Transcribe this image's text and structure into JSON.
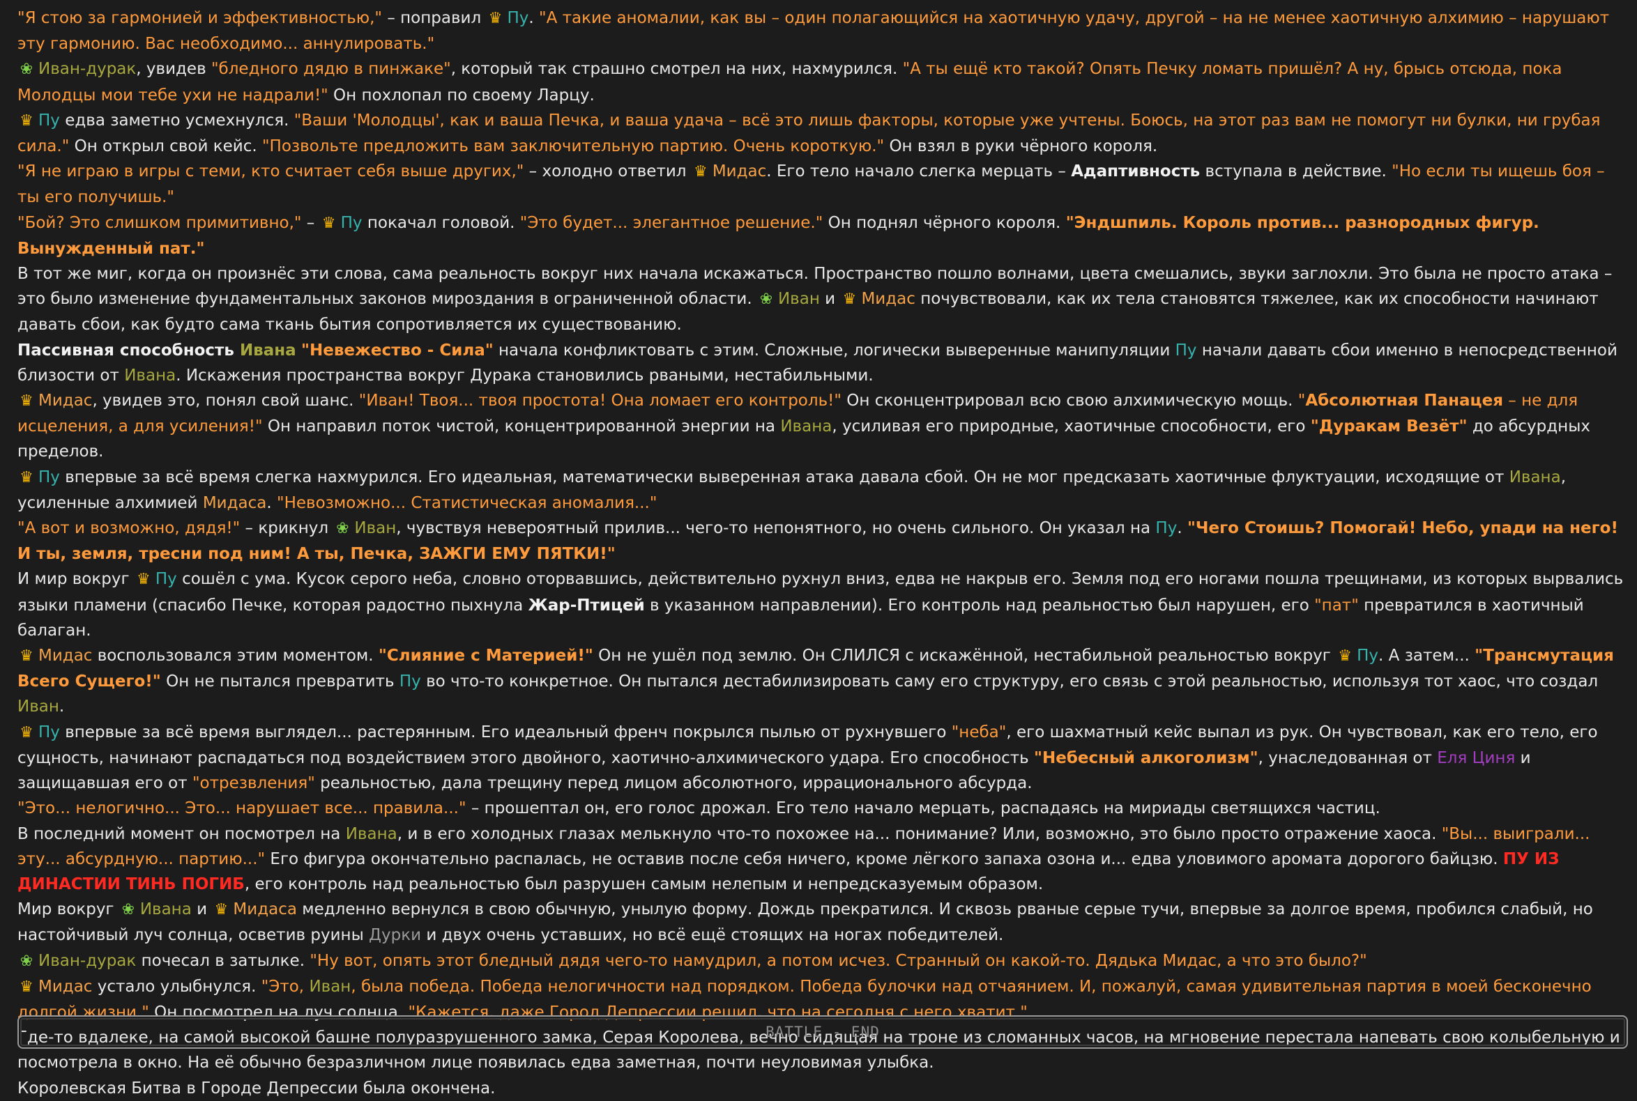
{
  "footer": {
    "label": "BATTLE - END"
  },
  "icons": {
    "crown": "crown-icon",
    "sprout": "sprout-icon"
  },
  "colors": {
    "quote": "#ff9b3c",
    "ivan": "#a7a83f",
    "pu": "#37b3ae",
    "midas": "#f4a24a",
    "durki": "#9a9a9a",
    "elya": "#a43ec0",
    "alert": "#ff2a22",
    "crown": "#f4b400",
    "sprout": "#7fd04a"
  },
  "paragraphs": [
    [
      {
        "c": "q",
        "t": "\"Я стою за гармонией и эффективностью,\""
      },
      {
        "c": "",
        "t": " – поправил "
      },
      {
        "i": "crown"
      },
      {
        "c": "pu",
        "t": "Пу"
      },
      {
        "c": "",
        "t": ". "
      },
      {
        "c": "q",
        "t": "\"А такие аномалии, как вы – один полагающийся на хаотичную удачу, другой – на не менее хаотичную алхимию – нарушают эту гармонию. Вас необходимо... аннулировать.\""
      }
    ],
    [
      {
        "i": "sprout"
      },
      {
        "c": "ivan",
        "t": "Иван-дурак"
      },
      {
        "c": "",
        "t": ", увидев "
      },
      {
        "c": "q",
        "t": "\"бледного дядю в пинжаке\""
      },
      {
        "c": "",
        "t": ", который так страшно смотрел на них, нахмурился. "
      },
      {
        "c": "q",
        "t": "\"А ты ещё кто такой? Опять Печку ломать пришёл? А ну, брысь отсюда, пока Молодцы мои тебе ухи не надрали!\""
      },
      {
        "c": "",
        "t": " Он похлопал по своему Ларцу."
      }
    ],
    [
      {
        "i": "crown"
      },
      {
        "c": "pu",
        "t": "Пу"
      },
      {
        "c": "",
        "t": " едва заметно усмехнулся. "
      },
      {
        "c": "q",
        "t": "\"Ваши 'Молодцы', как и ваша Печка, и ваша удача – всё это лишь факторы, которые уже учтены. Боюсь, на этот раз вам не помогут ни булки, ни грубая сила.\""
      },
      {
        "c": "",
        "t": " Он открыл свой кейс. "
      },
      {
        "c": "q",
        "t": "\"Позвольте предложить вам заключительную партию. Очень короткую.\""
      },
      {
        "c": "",
        "t": " Он взял в руки чёрного короля."
      }
    ],
    [
      {
        "c": "q",
        "t": "\"Я не играю в игры с теми, кто считает себя выше других,\""
      },
      {
        "c": "",
        "t": " – холодно ответил "
      },
      {
        "i": "crown"
      },
      {
        "c": "midas",
        "t": "Мидас"
      },
      {
        "c": "",
        "t": ". Его тело начало слегка мерцать – "
      },
      {
        "c": "b",
        "t": "Адаптивность"
      },
      {
        "c": "",
        "t": " вступала в действие. "
      },
      {
        "c": "q",
        "t": "\"Но если ты ищешь боя – ты его получишь.\""
      }
    ],
    [
      {
        "c": "q",
        "t": "\"Бой? Это слишком примитивно,\""
      },
      {
        "c": "",
        "t": " – "
      },
      {
        "i": "crown"
      },
      {
        "c": "pu",
        "t": "Пу"
      },
      {
        "c": "",
        "t": " покачал головой. "
      },
      {
        "c": "q",
        "t": "\"Это будет... элегантное решение.\""
      },
      {
        "c": "",
        "t": " Он поднял чёрного короля. "
      },
      {
        "c": "qb",
        "t": "\"Эндшпиль. Король против... разнородных фигур. Вынужденный пат.\""
      }
    ],
    [
      {
        "c": "",
        "t": "В тот же миг, когда он произнёс эти слова, сама реальность вокруг них начала искажаться. Пространство пошло волнами, цвета смешались, звуки заглохли. Это была не просто атака – это было изменение фундаментальных законов мироздания в ограниченной области. "
      },
      {
        "i": "sprout"
      },
      {
        "c": "ivan",
        "t": "Иван"
      },
      {
        "c": "",
        "t": " и "
      },
      {
        "i": "crown"
      },
      {
        "c": "midas",
        "t": "Мидас"
      },
      {
        "c": "",
        "t": " почувствовали, как их тела становятся тяжелее, как их способности начинают давать сбои, как будто сама ткань бытия сопротивляется их существованию."
      }
    ],
    [
      {
        "c": "b",
        "t": "Пассивная способность "
      },
      {
        "c": "ivan",
        "t": "Ивана",
        "bold": true
      },
      {
        "c": "",
        "t": " "
      },
      {
        "c": "qb",
        "t": "\"Невежество - Сила\""
      },
      {
        "c": "",
        "t": " начала конфликтовать с этим. Сложные, логически выверенные манипуляции "
      },
      {
        "c": "pu",
        "t": "Пу"
      },
      {
        "c": "",
        "t": " начали давать сбои именно в непосредственной близости от "
      },
      {
        "c": "ivan",
        "t": "Ивана"
      },
      {
        "c": "",
        "t": ". Искажения пространства вокруг Дурака становились рваными, нестабильными."
      }
    ],
    [
      {
        "i": "crown"
      },
      {
        "c": "midas",
        "t": "Мидас"
      },
      {
        "c": "",
        "t": ", увидев это, понял свой шанс. "
      },
      {
        "c": "q",
        "t": "\"Иван! Твоя... твоя простота! Она ломает его контроль!\""
      },
      {
        "c": "",
        "t": " Он сконцентрировал всю свою алхимическую мощь. "
      },
      {
        "c": "q",
        "t": "\""
      },
      {
        "c": "qb",
        "t": "Абсолютная Панацея"
      },
      {
        "c": "q",
        "t": " – не для исцеления, а для усиления!\""
      },
      {
        "c": "",
        "t": " Он направил поток чистой, концентрированной энергии на "
      },
      {
        "c": "ivan",
        "t": "Ивана"
      },
      {
        "c": "",
        "t": ", усиливая его природные, хаотичные способности, его "
      },
      {
        "c": "qb",
        "t": "\"Дуракам Везёт\""
      },
      {
        "c": "",
        "t": " до абсурдных пределов."
      }
    ],
    [
      {
        "i": "crown"
      },
      {
        "c": "pu",
        "t": "Пу"
      },
      {
        "c": "",
        "t": " впервые за всё время слегка нахмурился. Его идеальная, математически выверенная атака давала сбой. Он не мог предсказать хаотичные флуктуации, исходящие от "
      },
      {
        "c": "ivan",
        "t": "Ивана"
      },
      {
        "c": "",
        "t": ", усиленные алхимией "
      },
      {
        "c": "midas",
        "t": "Мидаса"
      },
      {
        "c": "",
        "t": ". "
      },
      {
        "c": "q",
        "t": "\"Невозможно... Статистическая аномалия...\""
      }
    ],
    [
      {
        "c": "q",
        "t": "\"А вот и возможно, дядя!\""
      },
      {
        "c": "",
        "t": " – крикнул "
      },
      {
        "i": "sprout"
      },
      {
        "c": "ivan",
        "t": "Иван"
      },
      {
        "c": "",
        "t": ", чувствуя невероятный прилив... чего-то непонятного, но очень сильного. Он указал на "
      },
      {
        "c": "pu",
        "t": "Пу"
      },
      {
        "c": "",
        "t": ". "
      },
      {
        "c": "qb",
        "t": "\"Чего Стоишь? Помогай! Небо, упади на него! И ты, земля, тресни под ним! А ты, Печка, ЗАЖГИ ЕМУ ПЯТКИ!\""
      }
    ],
    [
      {
        "c": "",
        "t": "И мир вокруг "
      },
      {
        "i": "crown"
      },
      {
        "c": "pu",
        "t": "Пу"
      },
      {
        "c": "",
        "t": " сошёл с ума. Кусок серого неба, словно оторвавшись, действительно рухнул вниз, едва не накрыв его. Земля под его ногами пошла трещинами, из которых вырвались языки пламени (спасибо Печке, которая радостно пыхнула "
      },
      {
        "c": "b",
        "t": "Жар-Птицей"
      },
      {
        "c": "",
        "t": " в указанном направлении). Его контроль над реальностью был нарушен, его "
      },
      {
        "c": "q",
        "t": "\"пат\""
      },
      {
        "c": "",
        "t": " превратился в хаотичный балаган."
      }
    ],
    [
      {
        "i": "crown"
      },
      {
        "c": "midas",
        "t": "Мидас"
      },
      {
        "c": "",
        "t": " воспользовался этим моментом. "
      },
      {
        "c": "qb",
        "t": "\"Слияние с Материей!\""
      },
      {
        "c": "",
        "t": " Он не ушёл под землю. Он СЛИЛСЯ с искажённой, нестабильной реальностью вокруг "
      },
      {
        "i": "crown"
      },
      {
        "c": "pu",
        "t": "Пу"
      },
      {
        "c": "",
        "t": ". А затем... "
      },
      {
        "c": "qb",
        "t": "\"Трансмутация Всего Сущего!\""
      },
      {
        "c": "",
        "t": " Он не пытался превратить "
      },
      {
        "c": "pu",
        "t": "Пу"
      },
      {
        "c": "",
        "t": " во что-то конкретное. Он пытался дестабилизировать саму его структуру, его связь с этой реальностью, используя тот хаос, что создал "
      },
      {
        "c": "ivan",
        "t": "Иван"
      },
      {
        "c": "",
        "t": "."
      }
    ],
    [
      {
        "i": "crown"
      },
      {
        "c": "pu",
        "t": "Пу"
      },
      {
        "c": "",
        "t": " впервые за всё время выглядел... растерянным. Его идеальный френч покрылся пылью от рухнувшего "
      },
      {
        "c": "q",
        "t": "\"неба\""
      },
      {
        "c": "",
        "t": ", его шахматный кейс выпал из рук. Он чувствовал, как его тело, его сущность, начинают распадаться под воздействием этого двойного, хаотично-алхимического удара. Его способность "
      },
      {
        "c": "qb",
        "t": "\"Небесный алкоголизм\""
      },
      {
        "c": "",
        "t": ", унаследованная от "
      },
      {
        "c": "elya",
        "t": "Еля Циня"
      },
      {
        "c": "",
        "t": " и защищавшая его от "
      },
      {
        "c": "q",
        "t": "\"отрезвления\""
      },
      {
        "c": "",
        "t": " реальностью, дала трещину перед лицом абсолютного, иррационального абсурда."
      }
    ],
    [
      {
        "c": "q",
        "t": "\"Это... нелогично... Это... нарушает все... правила...\""
      },
      {
        "c": "",
        "t": " – прошептал он, его голос дрожал. Его тело начало мерцать, распадаясь на мириады светящихся частиц."
      }
    ],
    [
      {
        "c": "",
        "t": "В последний момент он посмотрел на "
      },
      {
        "c": "ivan",
        "t": "Ивана"
      },
      {
        "c": "",
        "t": ", и в его холодных глазах мелькнуло что-то похожее на... понимание? Или, возможно, это было просто отражение хаоса. "
      },
      {
        "c": "q",
        "t": "\"Вы... выиграли... эту... абсурдную... партию...\""
      },
      {
        "c": "",
        "t": " Его фигура окончательно распалась, не оставив после себя ничего, кроме лёгкого запаха озона и... едва уловимого аромата дорогого байцзю. "
      },
      {
        "c": "red",
        "t": "ПУ ИЗ ДИНАСТИИ ТИНЬ ПОГИБ"
      },
      {
        "c": "",
        "t": ", его контроль над реальностью был разрушен самым нелепым и непредсказуемым образом."
      }
    ],
    [
      {
        "c": "",
        "t": "Мир вокруг "
      },
      {
        "i": "sprout"
      },
      {
        "c": "ivan",
        "t": "Ивана"
      },
      {
        "c": "",
        "t": " и "
      },
      {
        "i": "crown"
      },
      {
        "c": "midas",
        "t": "Мидаса"
      },
      {
        "c": "",
        "t": " медленно вернулся в свою обычную, унылую форму. Дождь прекратился. И сквозь рваные серые тучи, впервые за долгое время, пробился слабый, но настойчивый луч солнца, осветив руины "
      },
      {
        "c": "durki",
        "t": "Дурки"
      },
      {
        "c": "",
        "t": " и двух очень уставших, но всё ещё стоящих на ногах победителей."
      }
    ],
    [
      {
        "i": "sprout"
      },
      {
        "c": "ivan",
        "t": "Иван-дурак"
      },
      {
        "c": "",
        "t": " почесал в затылке. "
      },
      {
        "c": "q",
        "t": "\"Ну вот, опять этот бледный дядя чего-то намудрил, а потом исчез. Странный он какой-то. Дядька Мидас, а что это было?\""
      }
    ],
    [
      {
        "i": "crown"
      },
      {
        "c": "midas",
        "t": "Мидас"
      },
      {
        "c": "",
        "t": " устало улыбнулся. "
      },
      {
        "c": "q",
        "t": "\"Это, "
      },
      {
        "c": "ivan",
        "t": "Иван"
      },
      {
        "c": "q",
        "t": ", была победа. Победа нелогичности над порядком. Победа булочки над отчаянием. И, пожалуй, самая удивительная партия в моей бесконечно долгой жизни.\""
      },
      {
        "c": "",
        "t": " Он посмотрел на луч солнца. "
      },
      {
        "c": "q",
        "t": "\"Кажется, даже Город Депрессии решил, что на сегодня с него хватит.\""
      }
    ],
    [
      {
        "c": "",
        "t": "Где-то вдалеке, на самой высокой башне полуразрушенного замка, Серая Королева, вечно сидящая на троне из сломанных часов, на мгновение перестала напевать свою колыбельную и посмотрела в окно. На её обычно безразличном лице появилась едва заметная, почти неуловимая улыбка."
      }
    ],
    [
      {
        "c": "",
        "t": "Королевская Битва в Городе Депрессии была окончена."
      }
    ]
  ]
}
